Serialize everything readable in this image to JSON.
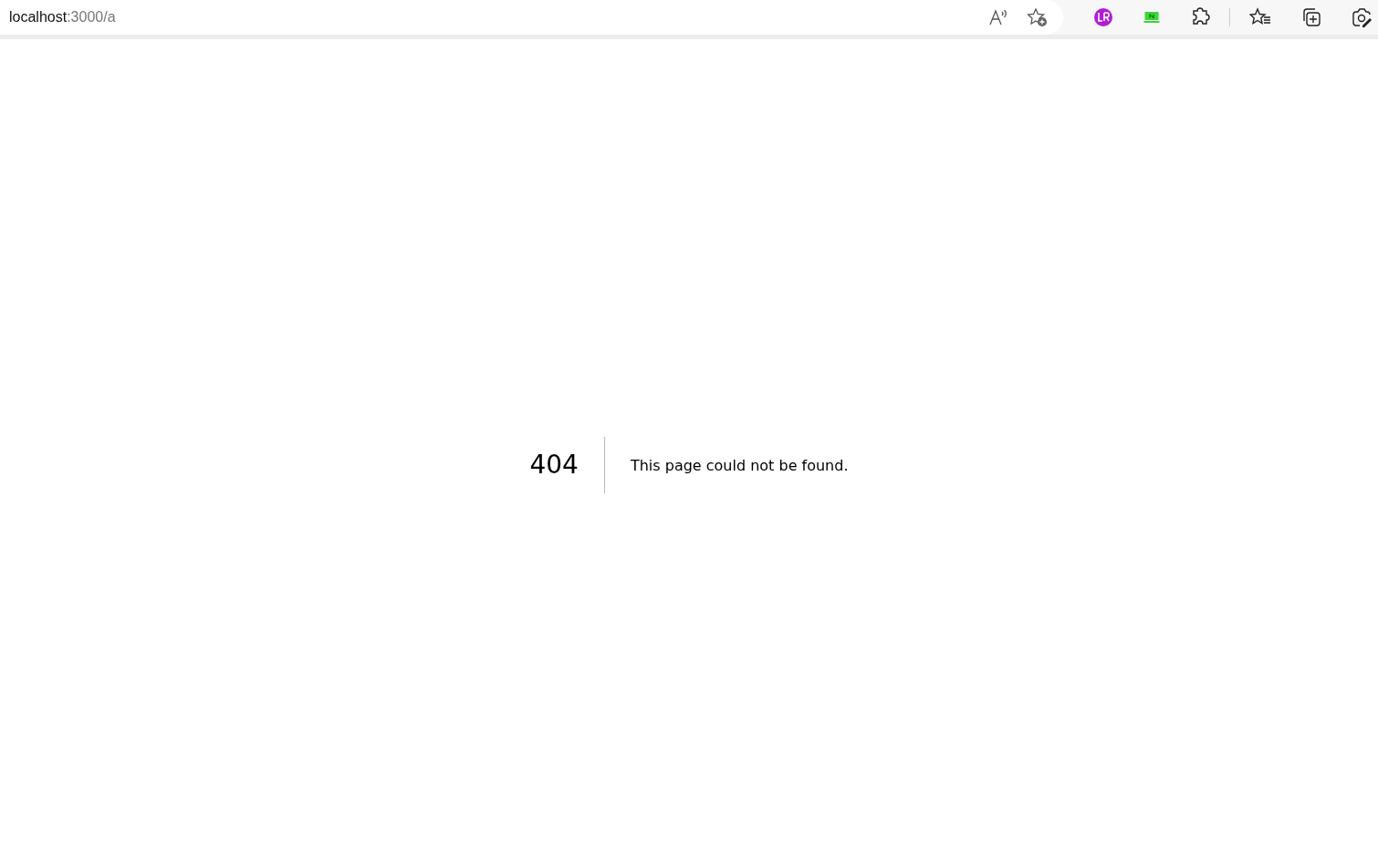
{
  "address_bar": {
    "host": "localhost",
    "path": ":3000/a"
  },
  "error": {
    "code": "404",
    "message": "This page could not be found."
  }
}
